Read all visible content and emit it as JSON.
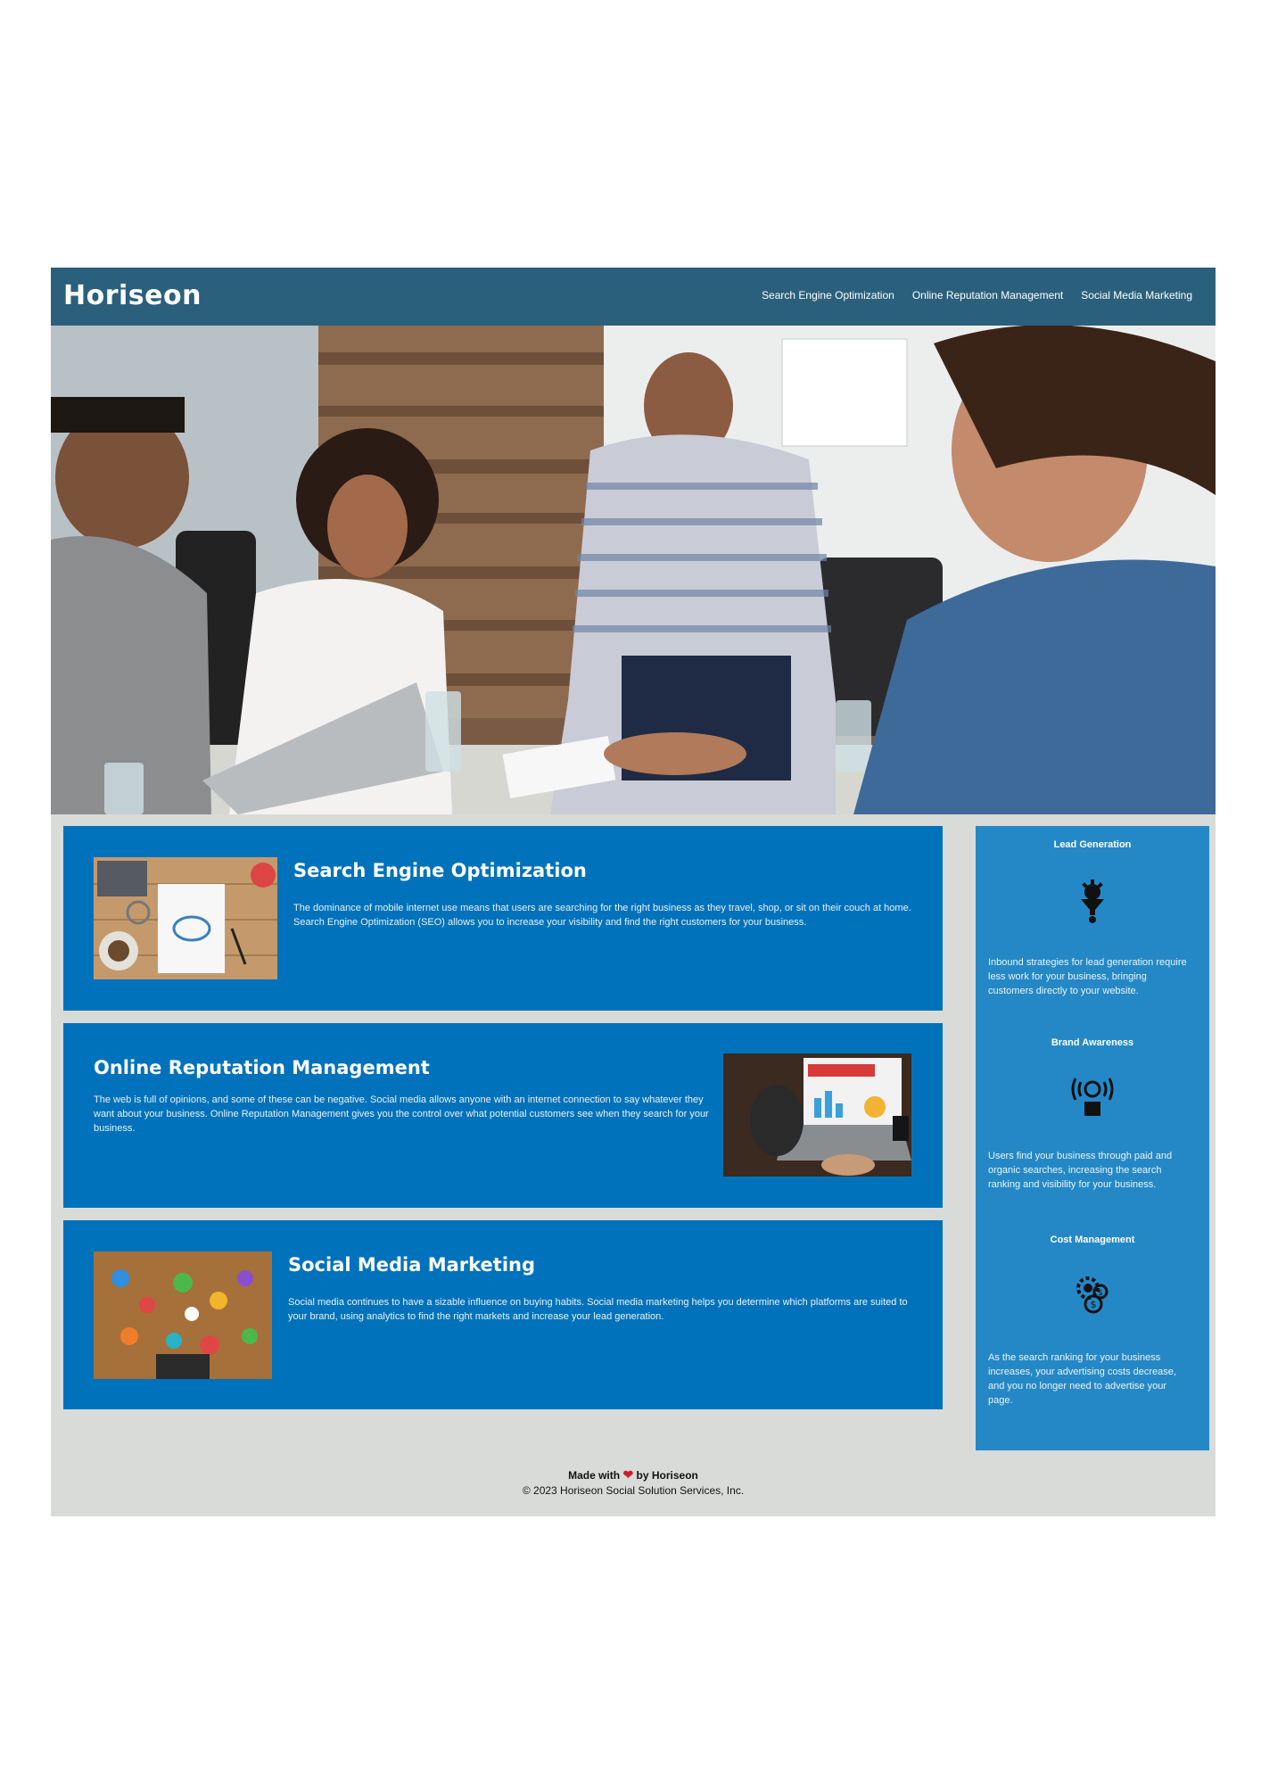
{
  "header": {
    "logo": "Horiseon",
    "nav": [
      {
        "label": "Search Engine Optimization"
      },
      {
        "label": "Online Reputation Management"
      },
      {
        "label": "Social Media Marketing"
      }
    ]
  },
  "sections": [
    {
      "title": "Search Engine Optimization",
      "text": "The dominance of mobile internet use means that users are searching for the right business as they travel, shop, or sit on their couch at home. Search Engine Optimization (SEO) allows you to increase your visibility and find the right customers for your business."
    },
    {
      "title": "Online Reputation Management",
      "text": "The web is full of opinions, and some of these can be negative. Social media allows anyone with an internet connection to say whatever they want about your business. Online Reputation Management gives you the control over what potential customers see when they search for your business."
    },
    {
      "title": "Social Media Marketing",
      "text": "Social media continues to have a sizable influence on buying habits. Social media marketing helps you determine which platforms are suited to your brand, using analytics to find the right markets and increase your lead generation."
    }
  ],
  "benefits": [
    {
      "title": "Lead Generation",
      "icon": "lead-generation-icon",
      "text": "Inbound strategies for lead generation require less work for your business, bringing customers directly to your website."
    },
    {
      "title": "Brand Awareness",
      "icon": "brand-awareness-icon",
      "text": "Users find your business through paid and organic searches, increasing the search ranking and visibility for your business."
    },
    {
      "title": "Cost Management",
      "icon": "cost-management-icon",
      "text": "As the search ranking for your business increases, your advertising costs decrease, and you no longer need to advertise your page."
    }
  ],
  "footer": {
    "made_prefix": "Made with",
    "made_suffix": "by Horiseon",
    "copyright": "© 2023 Horiseon Social Solution Services, Inc."
  },
  "colors": {
    "header": "#2a607c",
    "card": "#0072bb",
    "benefits": "#2588c6",
    "page": "#d9dbd9"
  }
}
